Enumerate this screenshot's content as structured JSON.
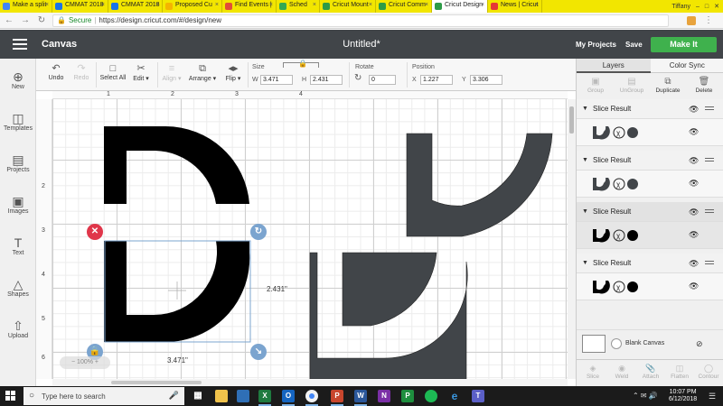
{
  "browser": {
    "tabs": [
      {
        "label": "Make a split",
        "fav": "#4285f4"
      },
      {
        "label": "CMMAT 2018",
        "fav": "#1a73e8"
      },
      {
        "label": "CMMAT 2018",
        "fav": "#1a73e8"
      },
      {
        "label": "Proposed Cu",
        "fav": "#f4b400"
      },
      {
        "label": "Find Events |",
        "fav": "#e04e39"
      },
      {
        "label": "Sched",
        "fav": "#34a853"
      },
      {
        "label": "Cricut Mount",
        "fav": "#2d9b47"
      },
      {
        "label": "Cricut Comm",
        "fav": "#2d9b47"
      },
      {
        "label": "Cricut Design",
        "fav": "#2d9b47",
        "active": true
      },
      {
        "label": "News | Cricut",
        "fav": "#e53935"
      }
    ],
    "user_name": "Tiffany",
    "secure_label": "Secure",
    "url": "https://design.cricut.com/#/design/new"
  },
  "header": {
    "app_name": "Canvas",
    "doc_title": "Untitled*",
    "my_projects": "My Projects",
    "save": "Save",
    "make_it": "Make It"
  },
  "toolbar": {
    "undo": "Undo",
    "redo": "Redo",
    "select_all": "Select All",
    "edit": "Edit",
    "align": "Align",
    "arrange": "Arrange",
    "flip": "Flip",
    "size_label": "Size",
    "w_label": "W",
    "w_value": "3.471",
    "h_label": "H",
    "h_value": "2.431",
    "rotate_label": "Rotate",
    "rotate_value": "0",
    "position_label": "Position",
    "x_label": "X",
    "x_value": "1.227",
    "y_label": "Y",
    "y_value": "3.306"
  },
  "sidebar": {
    "items": [
      {
        "label": "New",
        "icon": "plus-circle-icon"
      },
      {
        "label": "Templates",
        "icon": "shirt-icon"
      },
      {
        "label": "Projects",
        "icon": "projects-icon"
      },
      {
        "label": "Images",
        "icon": "image-icon"
      },
      {
        "label": "Text",
        "icon": "text-icon"
      },
      {
        "label": "Shapes",
        "icon": "shapes-icon"
      },
      {
        "label": "Upload",
        "icon": "upload-icon"
      }
    ]
  },
  "rulers": {
    "top": [
      "1",
      "2",
      "3",
      "4"
    ],
    "left": [
      "2",
      "3",
      "4",
      "5",
      "6"
    ]
  },
  "canvas": {
    "width_label": "3.471\"",
    "height_label": "2.431\"",
    "zoom": "100%",
    "colors": {
      "black_shape": "#000000",
      "gray_shape": "#414549",
      "delete_handle": "#e0364a",
      "handle_blue": "#7ba4cf"
    }
  },
  "layers_panel": {
    "tabs": {
      "layers": "Layers",
      "color_sync": "Color Sync"
    },
    "tools": {
      "group": "Group",
      "ungroup": "UnGroup",
      "duplicate": "Duplicate",
      "delete": "Delete"
    },
    "groups": [
      {
        "label": "Slice Result",
        "fill": "#414549"
      },
      {
        "label": "Slice Result",
        "fill": "#414549"
      },
      {
        "label": "Slice Result",
        "fill": "#000000",
        "selected": true
      },
      {
        "label": "Slice Result",
        "fill": "#000000"
      }
    ],
    "blank_canvas": "Blank Canvas",
    "bottom_tools": {
      "slice": "Slice",
      "weld": "Weld",
      "attach": "Attach",
      "flatten": "Flatten",
      "contour": "Contour"
    }
  },
  "taskbar": {
    "search_placeholder": "Type here to search",
    "time": "10:07 PM",
    "date": "6/12/2018"
  }
}
